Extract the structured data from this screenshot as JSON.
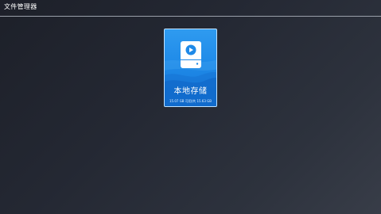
{
  "app": {
    "title": "文件管理器"
  },
  "storage": {
    "label": "本地存储",
    "capacity_text": "15.07 GB 可用/共 15.63 GB",
    "icon": "hard-drive-icon"
  },
  "colors": {
    "background_dark": "#1d2029",
    "background_light": "#383d48",
    "card_blue": "#1f8ae8",
    "card_border": "#bfe2ff",
    "divider": "#9aa0aa"
  }
}
